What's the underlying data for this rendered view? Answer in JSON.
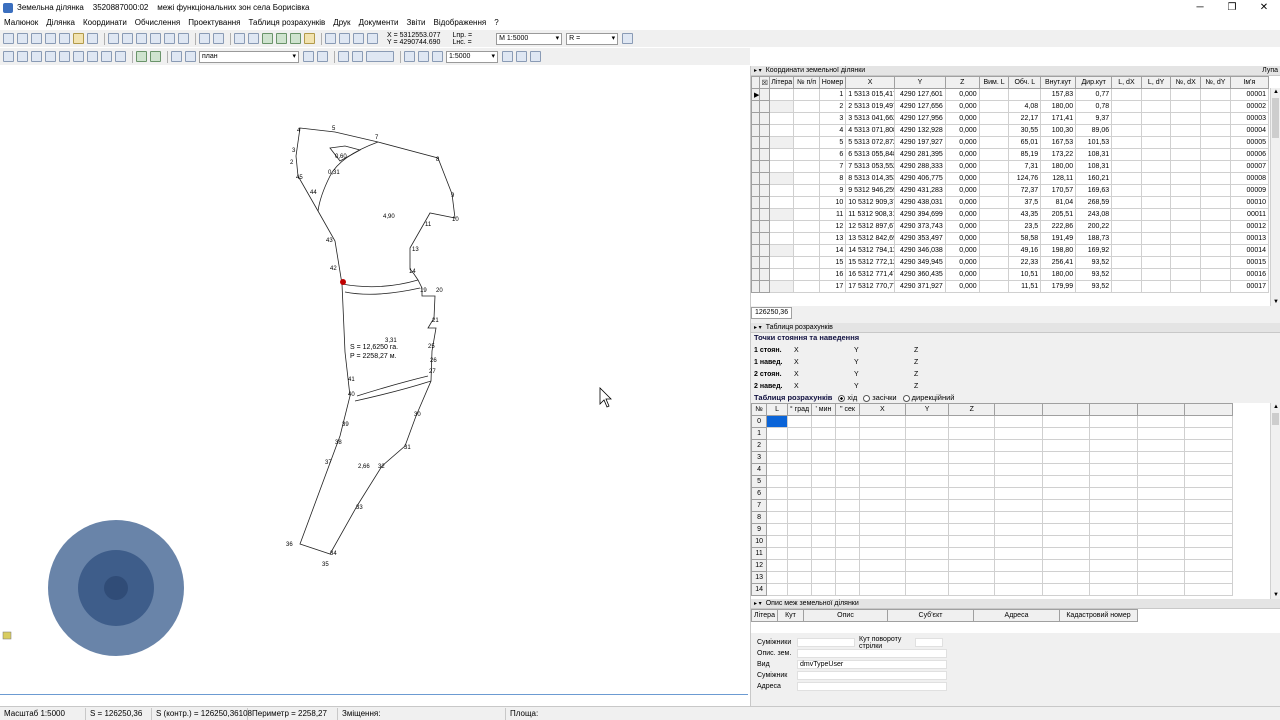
{
  "titlebar": {
    "title": "Земельна ділянка    3520887000:02    межі функціональних зон села Борисівка",
    "min": "─",
    "max": "❐",
    "close": "✕"
  },
  "menu": [
    "Малюнок",
    "Ділянка",
    "Координати",
    "Обчислення",
    "Проектування",
    "Таблиця розрахунків",
    "Друк",
    "Документи",
    "Звіти",
    "Відображення",
    "?"
  ],
  "toolbar": {
    "coords": "X = 5312553.077\nY = 4290744.690",
    "lnp": "Lпр. =\nLнс. =",
    "scale": "M 1:5000",
    "r": "R =",
    "layer": "план",
    "scale2": "1:5000"
  },
  "coords_panel": {
    "title": "Координати земельної ділянки",
    "right_label": "Лупа",
    "columns": [
      "Літера",
      "№ п/п",
      "Номер",
      "X",
      "Y",
      "Z",
      "Вим. L",
      "Обч. L",
      "Внут.кут",
      "Дир.кут",
      "L, dX",
      "L, dY",
      "№, dX",
      "№, dY",
      "Ім'я"
    ],
    "rows": [
      [
        "",
        "",
        "1",
        "1 5313 015,417",
        "4290 127,601",
        "0,000",
        "",
        "",
        "157,83",
        "0,77",
        "",
        "",
        "",
        "",
        "00001"
      ],
      [
        "",
        "",
        "2",
        "2 5313 019,497",
        "4290 127,656",
        "0,000",
        "",
        "4,08",
        "180,00",
        "0,78",
        "",
        "",
        "",
        "",
        "00002"
      ],
      [
        "",
        "",
        "3",
        "3 5313 041,662",
        "4290 127,956",
        "0,000",
        "",
        "22,17",
        "171,41",
        "9,37",
        "",
        "",
        "",
        "",
        "00003"
      ],
      [
        "",
        "",
        "4",
        "4 5313 071,808",
        "4290 132,928",
        "0,000",
        "",
        "30,55",
        "100,30",
        "89,06",
        "",
        "",
        "",
        "",
        "00004"
      ],
      [
        "",
        "",
        "5",
        "5 5313 072,872",
        "4290 197,927",
        "0,000",
        "",
        "65,01",
        "167,53",
        "101,53",
        "",
        "",
        "",
        "",
        "00005"
      ],
      [
        "",
        "",
        "6",
        "6 5313 055,848",
        "4290 281,395",
        "0,000",
        "",
        "85,19",
        "173,22",
        "108,31",
        "",
        "",
        "",
        "",
        "00006"
      ],
      [
        "",
        "",
        "7",
        "7 5313 053,552",
        "4290 288,333",
        "0,000",
        "",
        "7,31",
        "180,00",
        "108,31",
        "",
        "",
        "",
        "",
        "00007"
      ],
      [
        "",
        "",
        "8",
        "8 5313 014,353",
        "4290 406,775",
        "0,000",
        "",
        "124,76",
        "128,11",
        "160,21",
        "",
        "",
        "",
        "",
        "00008"
      ],
      [
        "",
        "",
        "9",
        "9 5312 946,259",
        "4290 431,283",
        "0,000",
        "",
        "72,37",
        "170,57",
        "169,63",
        "",
        "",
        "",
        "",
        "00009"
      ],
      [
        "",
        "",
        "10",
        "10 5312 909,375",
        "4290 438,031",
        "0,000",
        "",
        "37,5",
        "81,04",
        "268,59",
        "",
        "",
        "",
        "",
        "00010"
      ],
      [
        "",
        "",
        "11",
        "11 5312 908,311",
        "4290 394,699",
        "0,000",
        "",
        "43,35",
        "205,51",
        "243,08",
        "",
        "",
        "",
        "",
        "00011"
      ],
      [
        "",
        "",
        "12",
        "12 5312 897,671",
        "4290 373,743",
        "0,000",
        "",
        "23,5",
        "222,86",
        "200,22",
        "",
        "",
        "",
        "",
        "00012"
      ],
      [
        "",
        "",
        "13",
        "13 5312 842,699",
        "4290 353,497",
        "0,000",
        "",
        "58,58",
        "191,49",
        "188,73",
        "",
        "",
        "",
        "",
        "00013"
      ],
      [
        "",
        "",
        "14",
        "14 5312 794,111",
        "4290 346,038",
        "0,000",
        "",
        "49,16",
        "198,80",
        "169,92",
        "",
        "",
        "",
        "",
        "00014"
      ],
      [
        "",
        "",
        "15",
        "15 5312 772,123",
        "4290 349,945",
        "0,000",
        "",
        "22,33",
        "256,41",
        "93,52",
        "",
        "",
        "",
        "",
        "00015"
      ],
      [
        "",
        "",
        "16",
        "16 5312 771,478",
        "4290 360,435",
        "0,000",
        "",
        "10,51",
        "180,00",
        "93,52",
        "",
        "",
        "",
        "",
        "00016"
      ],
      [
        "",
        "",
        "17",
        "17 5312 770,772",
        "4290 371,927",
        "0,000",
        "",
        "11,51",
        "179,99",
        "93,52",
        "",
        "",
        "",
        "",
        "00017"
      ]
    ],
    "footer_tab": "126250,36"
  },
  "calc_panel": {
    "title": "Таблиця розрахунків",
    "sub_title": "Точки стояння та наведення",
    "rows": [
      {
        "label": "1 стоян.",
        "x": "X",
        "y": "Y",
        "z": "Z"
      },
      {
        "label": "1 навед.",
        "x": "X",
        "y": "Y",
        "z": "Z"
      },
      {
        "label": "2 стоян.",
        "x": "X",
        "y": "Y",
        "z": "Z"
      },
      {
        "label": "2 навед.",
        "x": "X",
        "y": "Y",
        "z": "Z"
      }
    ],
    "table_label": "Таблиця розрахунків",
    "radio": [
      "хід",
      "засічки",
      "дирекційний"
    ],
    "columns": [
      "№",
      "L",
      "° град",
      "' мин",
      "'' сек",
      "X",
      "Y",
      "Z",
      "",
      "",
      "",
      "",
      ""
    ],
    "row_numbers": [
      "0",
      "1",
      "2",
      "3",
      "4",
      "5",
      "6",
      "7",
      "8",
      "9",
      "10",
      "11",
      "12",
      "13",
      "14"
    ]
  },
  "desc_panel": {
    "title": "Опис меж земельної ділянки",
    "columns": [
      "Літера",
      "Кут",
      "Опис",
      "Суб'єкт",
      "Адреса",
      "Кадастровий номер"
    ],
    "fields": [
      {
        "label": "Суміжники",
        "value": "",
        "extra": "Кут повороту стрілки"
      },
      {
        "label": "Опис. зем.",
        "value": "",
        "extra": ""
      },
      {
        "label": "Вид",
        "value": "dmvTypeUser",
        "extra": ""
      },
      {
        "label": "Суміжник",
        "value": "",
        "extra": ""
      },
      {
        "label": "Адреса",
        "value": "",
        "extra": ""
      }
    ]
  },
  "drawing": {
    "area_label": "S = 12,6250 га.",
    "perim_label": "P = 2258,27 м.",
    "small_labels": [
      "0,60",
      "0,31",
      "4,90",
      "3,31",
      "2,66"
    ],
    "point_numbers": [
      "1",
      "2",
      "3",
      "4",
      "5",
      "6",
      "7",
      "8",
      "9",
      "10",
      "11",
      "12",
      "13",
      "14",
      "15",
      "16",
      "17",
      "18",
      "19",
      "20",
      "21",
      "22",
      "23",
      "24",
      "25",
      "26",
      "27",
      "28",
      "29",
      "30",
      "31",
      "32",
      "33",
      "34",
      "35",
      "36",
      "37",
      "38",
      "39",
      "40",
      "41",
      "42",
      "43",
      "44",
      "45"
    ]
  },
  "status": {
    "scale": "Масштаб 1:5000",
    "s": "S = 126250,36",
    "s_control": "S (контр.) = 126250,36108",
    "perimeter": "Периметр = 2258,27",
    "shift": "Зміщення:",
    "area": "Площа:"
  }
}
